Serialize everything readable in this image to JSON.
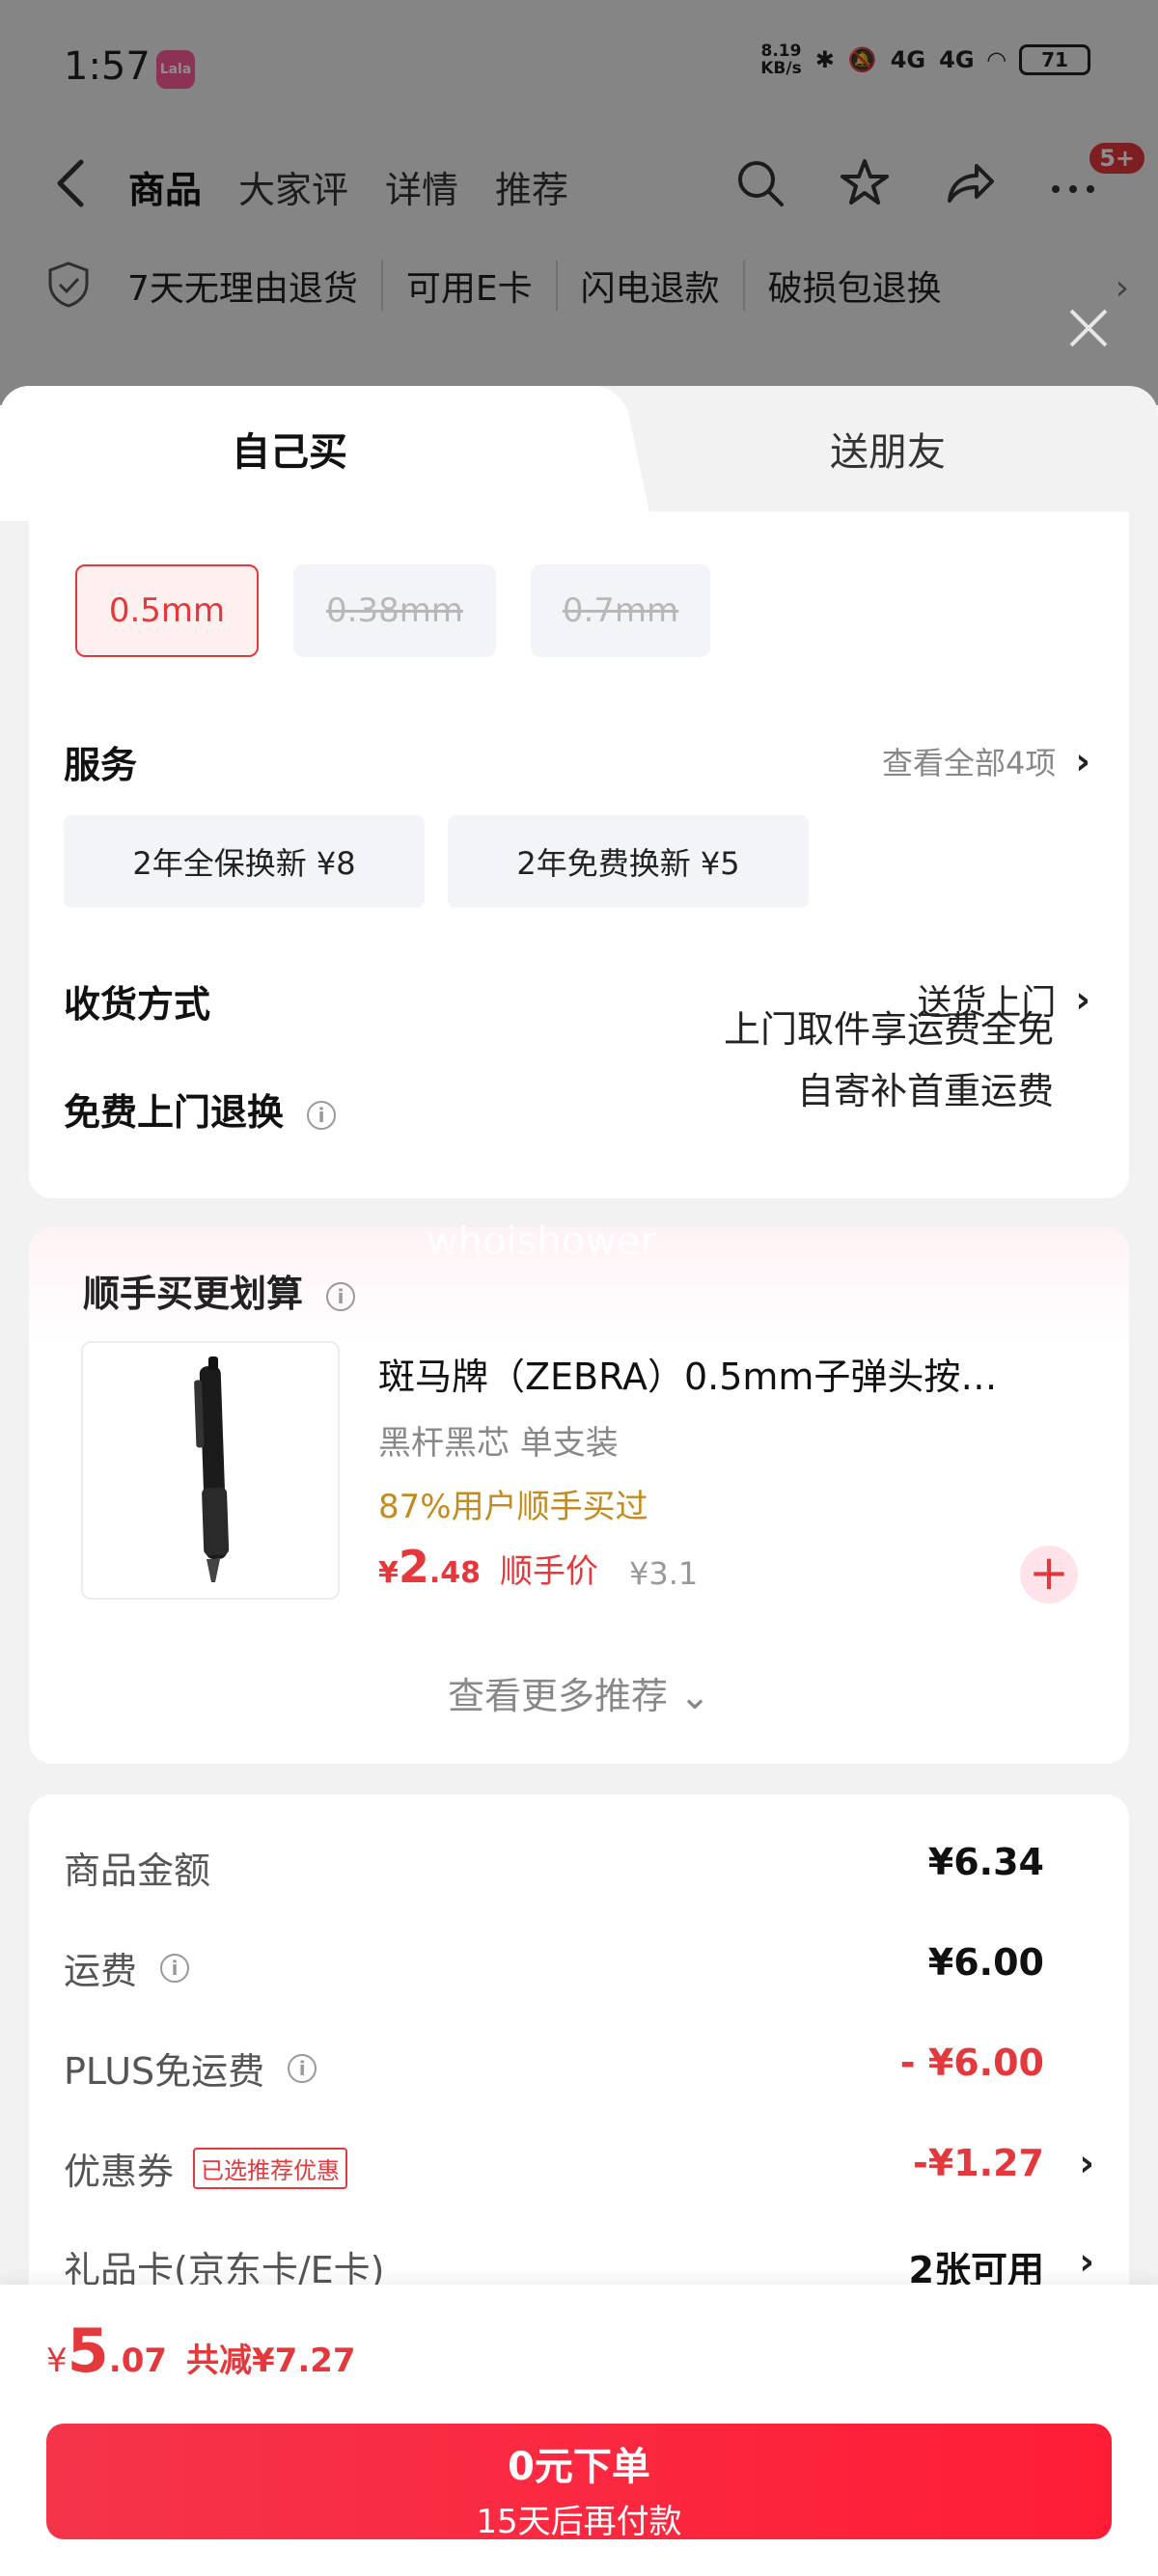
{
  "status_bar": {
    "time": "1:57",
    "app_icon_text": "Lala",
    "net_speed_value": "8.19",
    "net_speed_unit": "KB/s",
    "signal1": "4G",
    "signal2": "4G",
    "battery": "71"
  },
  "nav": {
    "tabs": [
      "商品",
      "大家评",
      "详情",
      "推荐"
    ],
    "badge": "5+"
  },
  "service_strip": {
    "items": [
      "7天无理由退货",
      "可用E卡",
      "闪电退款",
      "破损包退换"
    ]
  },
  "sheet": {
    "tab_self": "自己买",
    "tab_friend": "送朋友"
  },
  "specs": {
    "options": [
      "0.5mm",
      "0.38mm",
      "0.7mm"
    ],
    "selected": "0.5mm"
  },
  "service": {
    "label": "服务",
    "view_all": "查看全部4项",
    "options": [
      "2年全保换新  ¥8",
      "2年免费换新  ¥5"
    ]
  },
  "delivery": {
    "label": "收货方式",
    "value": "送货上门"
  },
  "free_return": {
    "label": "免费上门退换",
    "line1": "上门取件享运费全免",
    "line2": "自寄补首重运费"
  },
  "upsell": {
    "watermark": "whoishower",
    "title": "顺手买更划算",
    "product_name": "斑马牌（ZEBRA）0.5mm子弹头按…",
    "product_spec": "黑杆黑芯 单支装",
    "product_pct": "87%用户顺手买过",
    "price_currency": "¥",
    "price_int": "2",
    "price_dec": ".48",
    "price_label": "顺手价",
    "original_price": "¥3.1",
    "more": "查看更多推荐 ⌄"
  },
  "price": {
    "goods_label": "商品金额",
    "goods_value": "¥6.34",
    "shipping_label": "运费",
    "shipping_value": "¥6.00",
    "plus_label": "PLUS免运费",
    "plus_value": "- ¥6.00",
    "coupon_label": "优惠券",
    "coupon_tag": "已选推荐优惠",
    "coupon_value": "-¥1.27",
    "giftcard_label": "礼品卡(京东卡/E卡)",
    "giftcard_value": "2张可用"
  },
  "bottom": {
    "currency": "¥",
    "total_int": "5",
    "total_dec": ".07",
    "saved": "共减¥7.27",
    "order_line1": "0元下单",
    "order_line2": "15天后再付款"
  },
  "colors": {
    "accent": "#e4393c",
    "gold": "#c58a1e"
  }
}
